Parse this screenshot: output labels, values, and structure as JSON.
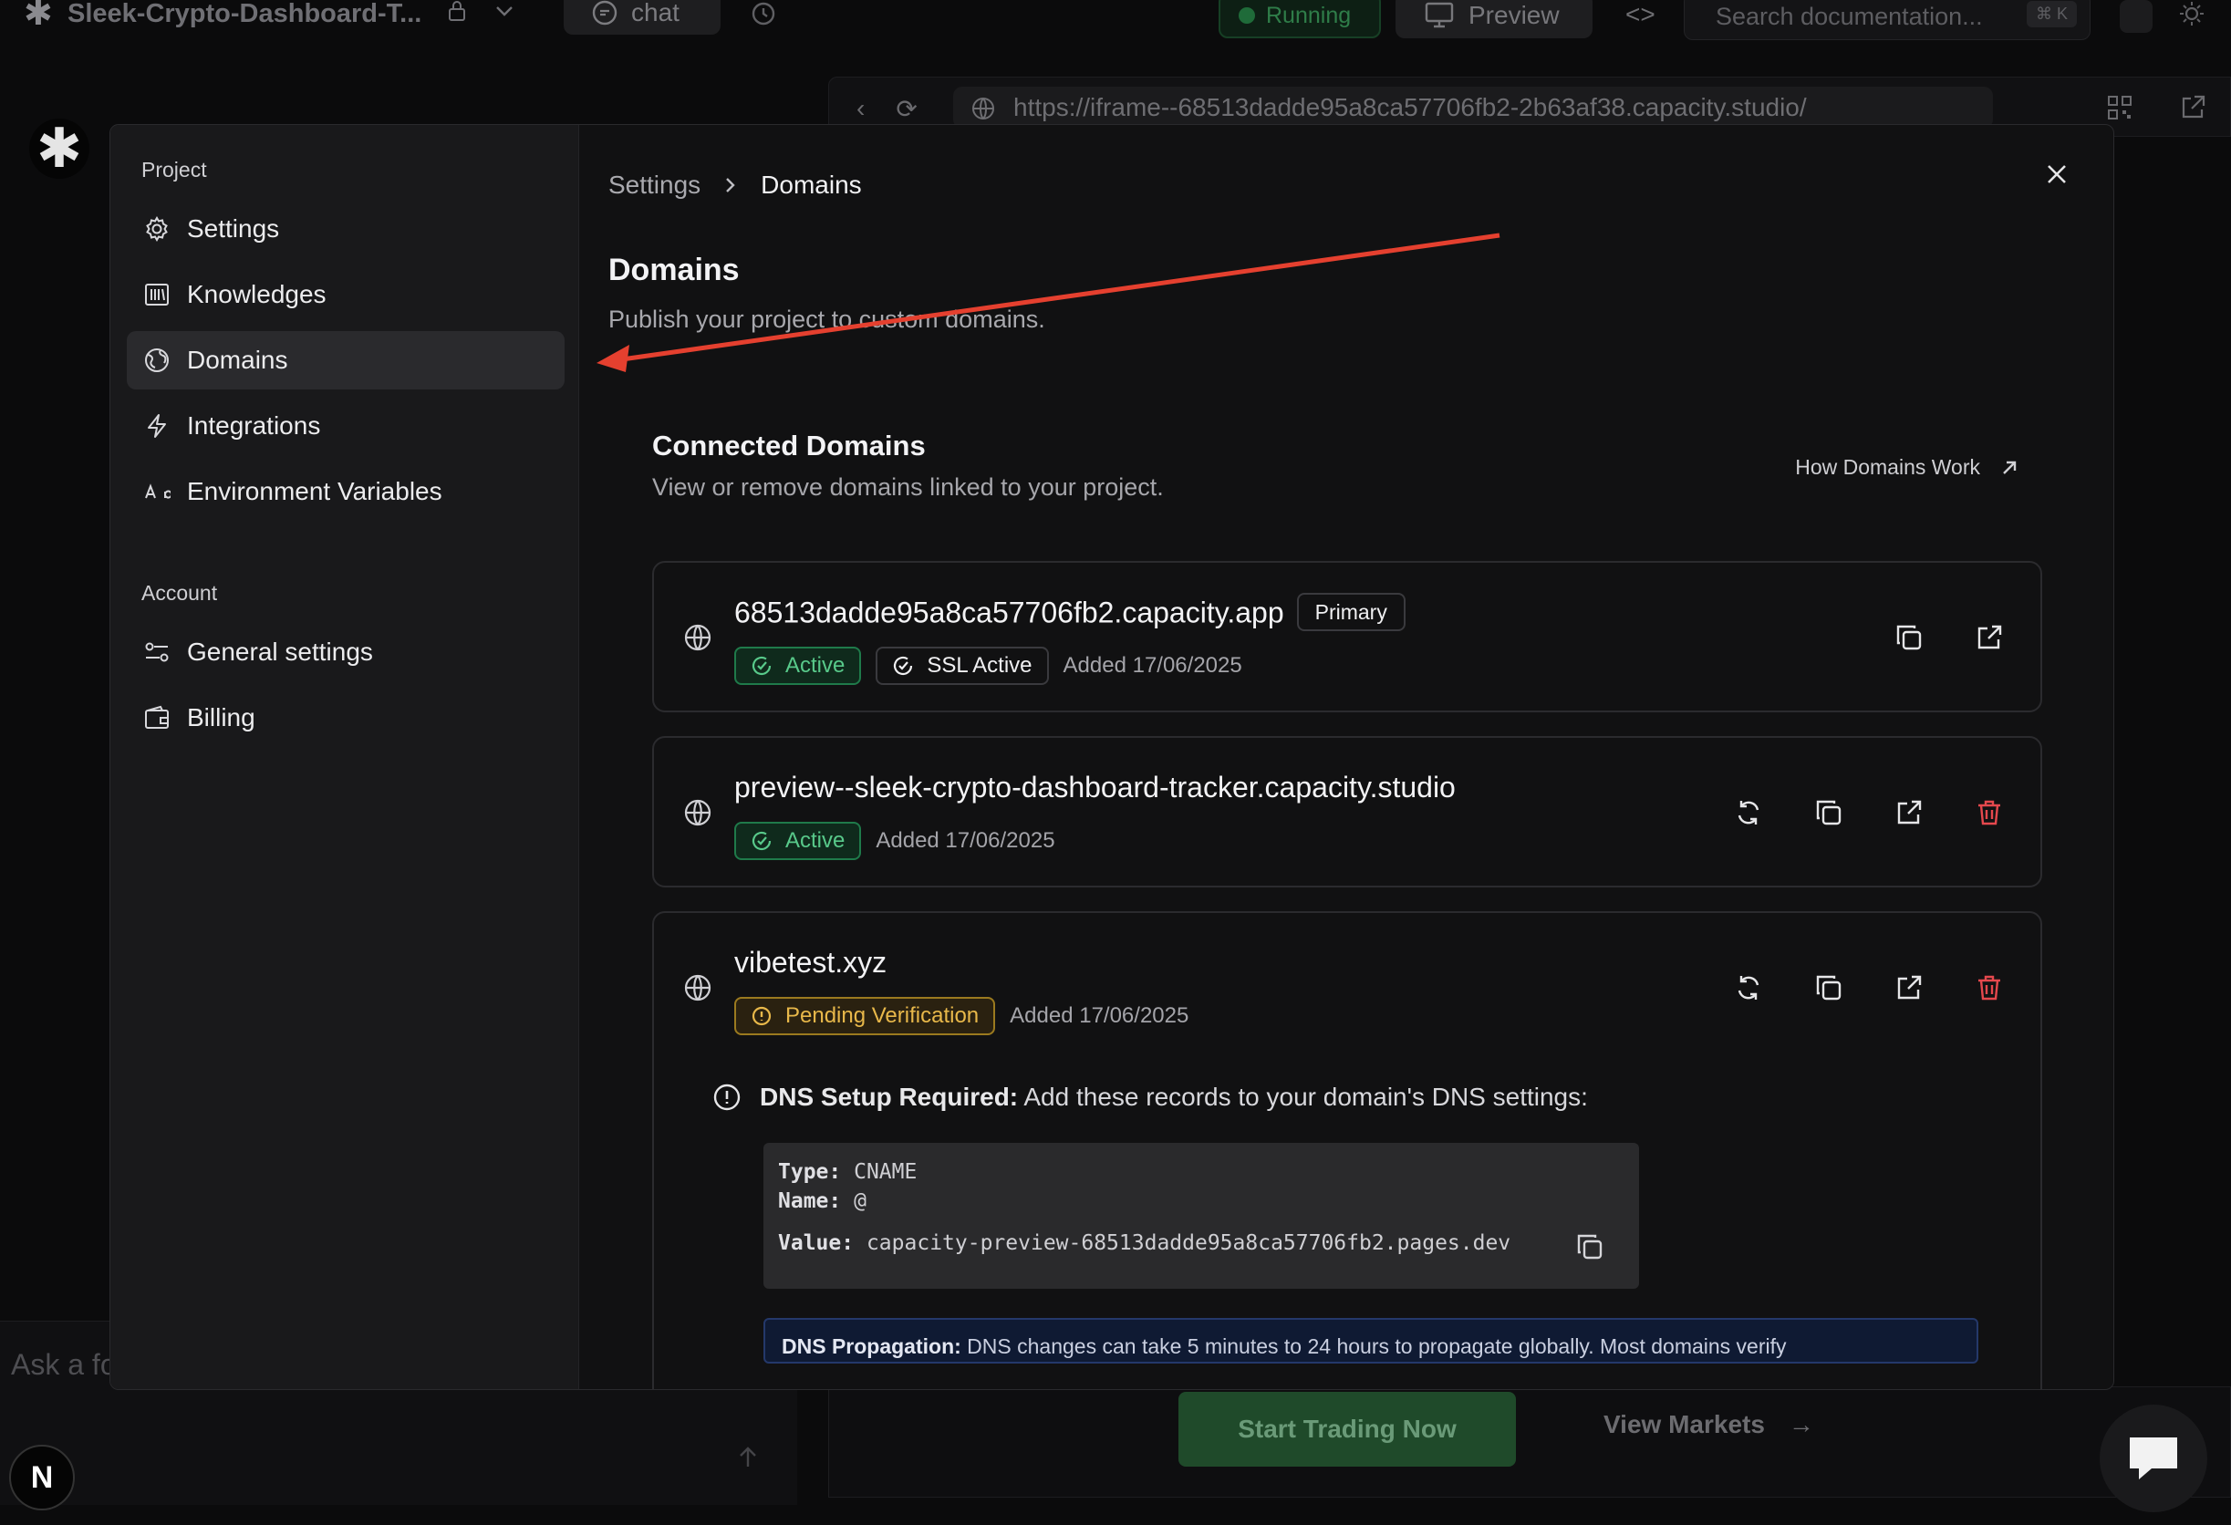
{
  "topbar": {
    "project_title": "Sleek-Crypto-Dashboard-T...",
    "chat_tab": "chat",
    "status": "Running",
    "preview_label": "Preview",
    "search_placeholder": "Search documentation...",
    "search_shortcut": "⌘ K"
  },
  "browser": {
    "url": "https://iframe--68513dadde95a8ca57706fb2-2b63af38.capacity.studio/"
  },
  "sidebar": {
    "project_heading": "Project",
    "project_items": [
      {
        "label": "Settings",
        "icon": "gear-icon"
      },
      {
        "label": "Knowledges",
        "icon": "library-icon"
      },
      {
        "label": "Domains",
        "icon": "globe-icon",
        "active": true
      },
      {
        "label": "Integrations",
        "icon": "lightning-icon"
      },
      {
        "label": "Environment Variables",
        "icon": "text-aa-icon"
      }
    ],
    "account_heading": "Account",
    "account_items": [
      {
        "label": "General settings",
        "icon": "sliders-icon"
      },
      {
        "label": "Billing",
        "icon": "wallet-icon"
      }
    ]
  },
  "main": {
    "breadcrumb": {
      "parent": "Settings",
      "separator": ">",
      "current": "Domains"
    },
    "title": "Domains",
    "subtitle": "Publish your project to custom domains.",
    "section_title": "Connected Domains",
    "section_subtitle": "View or remove domains linked to your project.",
    "how_link": "How Domains Work",
    "domains": [
      {
        "name": "68513dadde95a8ca57706fb2.capacity.app",
        "primary_label": "Primary",
        "status": "Active",
        "ssl": "SSL Active",
        "added": "Added 17/06/2025"
      },
      {
        "name": "preview--sleek-crypto-dashboard-tracker.capacity.studio",
        "status": "Active",
        "added": "Added 17/06/2025"
      },
      {
        "name": "vibetest.xyz",
        "status": "Pending Verification",
        "added": "Added 17/06/2025"
      }
    ],
    "dns": {
      "required_bold": "DNS Setup Required:",
      "required_text": " Add these records to your domain's DNS settings:",
      "type_label": "Type:",
      "type_value": "CNAME",
      "name_label": "Name:",
      "name_value": "@",
      "value_label": "Value:",
      "value_value": "capacity-preview-68513dadde95a8ca57706fb2.pages.dev",
      "propagation_bold": "DNS Propagation:",
      "propagation_text": " DNS changes can take 5 minutes to 24 hours to propagate globally. Most domains verify"
    }
  },
  "background": {
    "ask_placeholder": "Ask a fo",
    "avatar_letter": "N",
    "start_trading": "Start Trading Now",
    "view_markets": "View Markets"
  },
  "colors": {
    "active_green": "#58c98a",
    "pending_amber": "#e8b84a",
    "delete_red": "#e5484d",
    "annotation_arrow": "#e5402f"
  }
}
